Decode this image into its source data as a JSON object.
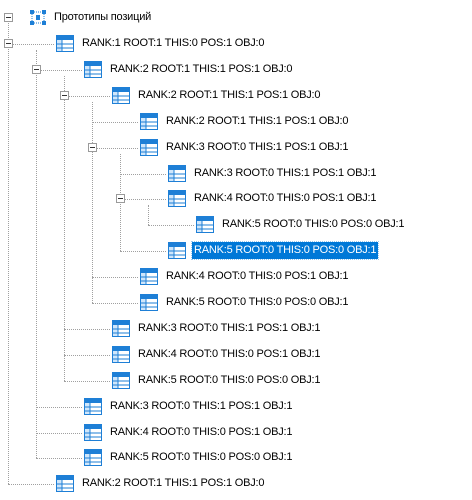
{
  "tree": {
    "root": {
      "label": "Прототипы позиций",
      "icon": "prototype-grid-icon"
    },
    "node_icon": "table-icon",
    "colors": {
      "selection": "#0078d7",
      "icon_blue": "#1e7fd6",
      "icon_light": "#cfe6fb",
      "guide": "#a0a0a0"
    },
    "nodes": [
      {
        "label": "RANK:1 ROOT:1 THIS:0 POS:1 OBJ:0",
        "depth": 0,
        "expanded": true
      },
      {
        "label": "RANK:2 ROOT:1 THIS:1 POS:1 OBJ:0",
        "depth": 1,
        "expanded": true
      },
      {
        "label": "RANK:2 ROOT:1 THIS:1 POS:1 OBJ:0",
        "depth": 2,
        "expanded": true
      },
      {
        "label": "RANK:2 ROOT:1 THIS:1 POS:1 OBJ:0",
        "depth": 3
      },
      {
        "label": "RANK:3 ROOT:0 THIS:1 POS:1 OBJ:1",
        "depth": 3,
        "expanded": true
      },
      {
        "label": "RANK:3 ROOT:0 THIS:1 POS:1 OBJ:1",
        "depth": 4
      },
      {
        "label": "RANK:4 ROOT:0 THIS:0 POS:1 OBJ:1",
        "depth": 4,
        "expanded": true
      },
      {
        "label": "RANK:5 ROOT:0 THIS:0 POS:0 OBJ:1",
        "depth": 5
      },
      {
        "label": "RANK:5 ROOT:0 THIS:0 POS:0 OBJ:1",
        "depth": 4,
        "selected": true
      },
      {
        "label": "RANK:4 ROOT:0 THIS:0 POS:1 OBJ:1",
        "depth": 3
      },
      {
        "label": "RANK:5 ROOT:0 THIS:0 POS:0 OBJ:1",
        "depth": 3
      },
      {
        "label": "RANK:3 ROOT:0 THIS:1 POS:1 OBJ:1",
        "depth": 2
      },
      {
        "label": "RANK:4 ROOT:0 THIS:0 POS:1 OBJ:1",
        "depth": 2
      },
      {
        "label": "RANK:5 ROOT:0 THIS:0 POS:0 OBJ:1",
        "depth": 2
      },
      {
        "label": "RANK:3 ROOT:0 THIS:1 POS:1 OBJ:1",
        "depth": 1
      },
      {
        "label": "RANK:4 ROOT:0 THIS:0 POS:1 OBJ:1",
        "depth": 1
      },
      {
        "label": "RANK:5 ROOT:0 THIS:0 POS:0 OBJ:1",
        "depth": 1
      },
      {
        "label": "RANK:2 ROOT:1 THIS:1 POS:1 OBJ:0",
        "depth": 0
      }
    ]
  }
}
